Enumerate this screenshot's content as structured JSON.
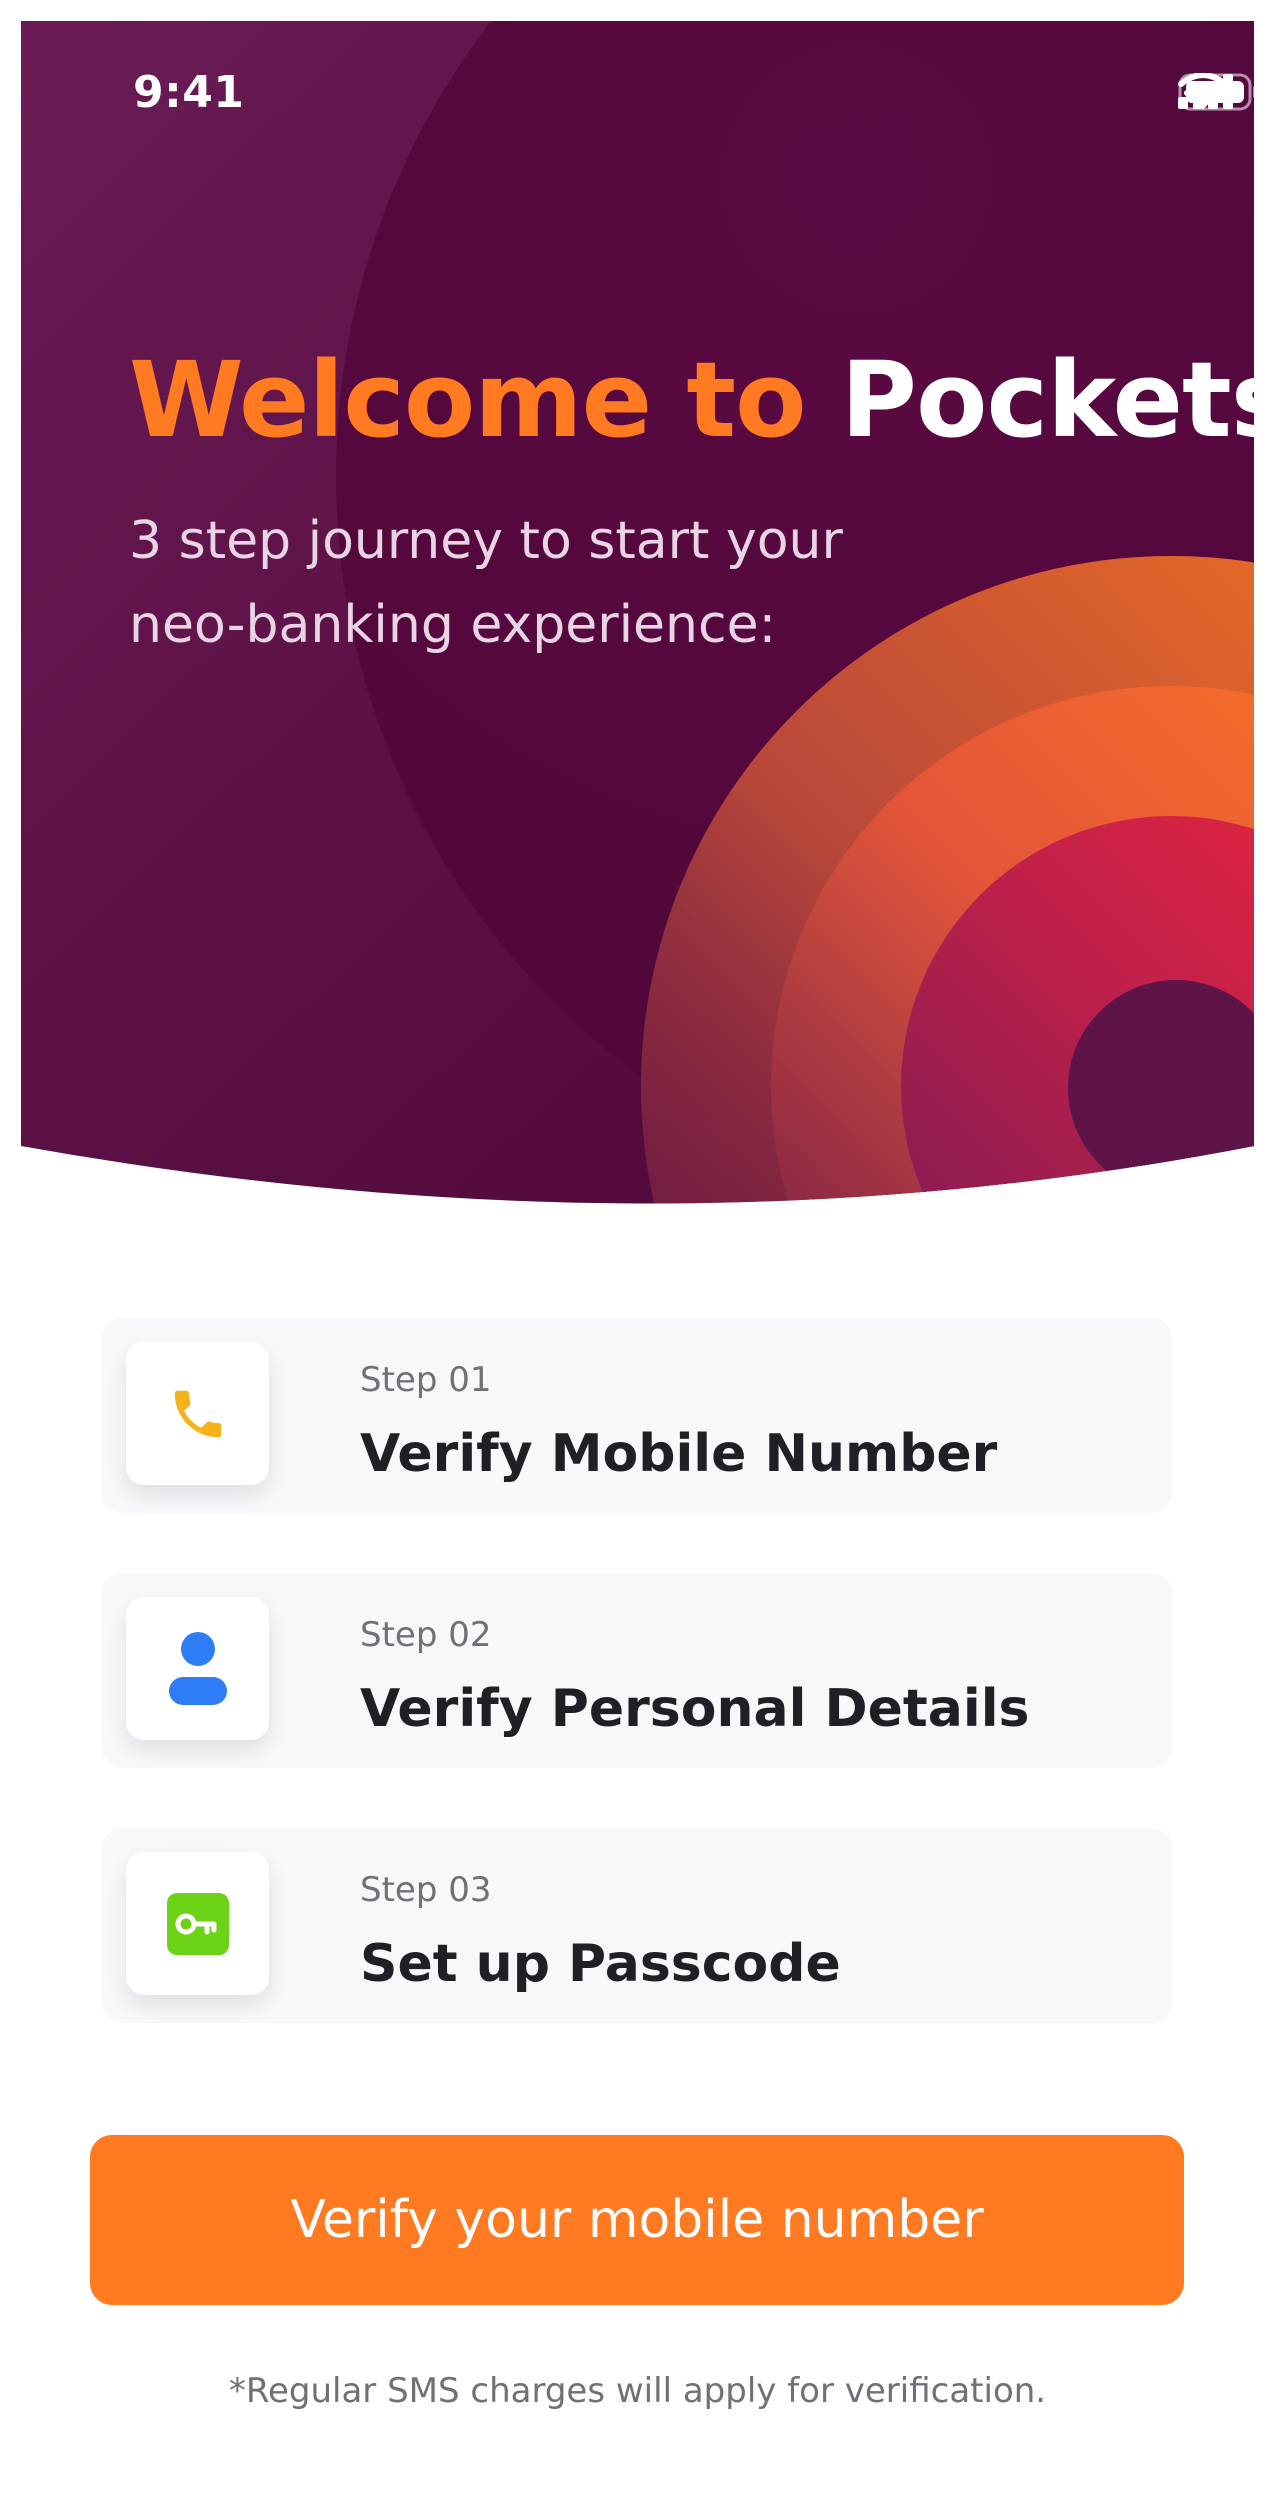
{
  "status_bar": {
    "time": "9:41",
    "icons": [
      "cellular-signal-icon",
      "wifi-icon",
      "battery-icon"
    ]
  },
  "hero": {
    "title_highlight": "Welcome to",
    "title_brand": "Pockets!",
    "subtitle": "3 step journey to start your neo-banking experience:"
  },
  "steps": [
    {
      "label": "Step 01",
      "title": "Verify Mobile Number",
      "icon": "phone-icon",
      "icon_color": "#f7b21b"
    },
    {
      "label": "Step 02",
      "title": "Verify Personal Details",
      "icon": "person-icon",
      "icon_color": "#2f7df6"
    },
    {
      "label": "Step 03",
      "title": "Set up Passcode",
      "icon": "key-icon",
      "icon_color": "#6cd216"
    }
  ],
  "cta": {
    "label": "Verify your mobile number"
  },
  "footnote": "*Regular SMS charges will apply for verification.",
  "colors": {
    "brand_purple": "#5c1349",
    "accent_orange": "#ff7a21",
    "accent_red": "#e2203f",
    "card_background": "#f7f8fa"
  }
}
